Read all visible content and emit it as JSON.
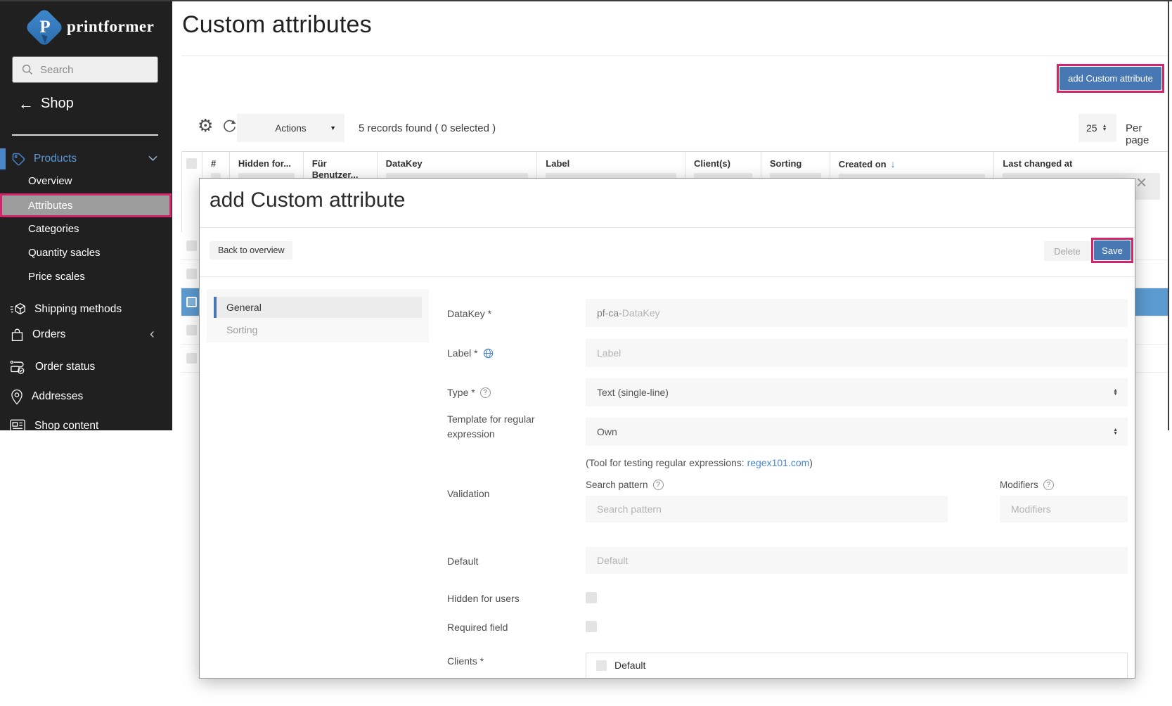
{
  "page": {
    "title": "Custom attributes"
  },
  "sidebar": {
    "logo": "printformer",
    "logo_letter": "P",
    "search": {
      "placeholder": "Search"
    },
    "back": {
      "label": "Shop"
    },
    "products": {
      "label": "Products",
      "items": [
        "Overview",
        "Attributes",
        "Categories",
        "Quantity sacles",
        "Price scales"
      ],
      "active_item": "Attributes"
    },
    "items": [
      "Shipping methods",
      "Orders",
      "Order status",
      "Addresses",
      "Shop content"
    ]
  },
  "toolbar": {
    "actions": "Actions",
    "records": "5 records found ( 0 selected )",
    "per_page_value": "25",
    "per_page_label": "Per page",
    "add_button": "add Custom attribute"
  },
  "table": {
    "columns": [
      "#",
      "Hidden for...",
      "Für Benutzer...",
      "DataKey",
      "Label",
      "Client(s)",
      "Sorting",
      "Created on",
      "Last changed at"
    ],
    "sorted_column": "Created on"
  },
  "modal": {
    "title": "add Custom attribute",
    "back_button": "Back to overview",
    "delete_button": "Delete",
    "save_button": "Save",
    "nav": {
      "general": "General",
      "sorting": "Sorting",
      "active": "General"
    },
    "form": {
      "datakey": {
        "label": "DataKey *",
        "prefix": "pf-ca-",
        "placeholder": "DataKey"
      },
      "label": {
        "label": "Label *",
        "placeholder": "Label"
      },
      "type": {
        "label": "Type *",
        "value": "Text (single-line)"
      },
      "template": {
        "label": "Template for regular expression",
        "value": "Own"
      },
      "regex_note": {
        "prefix": "(Tool for testing regular expressions: ",
        "link": "regex101.com",
        "suffix": ")"
      },
      "validation": {
        "label": "Validation",
        "search_pattern": {
          "label": "Search pattern",
          "placeholder": "Search pattern"
        },
        "modifiers": {
          "label": "Modifiers",
          "placeholder": "Modifiers"
        }
      },
      "default": {
        "label": "Default",
        "placeholder": "Default"
      },
      "hidden_for_users": {
        "label": "Hidden for users",
        "checked": false
      },
      "required_field": {
        "label": "Required field",
        "checked": false
      },
      "clients": {
        "label": "Clients *",
        "options": [
          "Default"
        ]
      }
    }
  },
  "icons": {
    "gear": "⚙",
    "dropdown": "▼",
    "sort_desc": "↓",
    "back_arrow": "←",
    "chevron_left": "‹",
    "close": "×",
    "select_up": "▲",
    "select_down": "▼",
    "question": "?"
  },
  "colors": {
    "accent_blue": "#4878b3",
    "annotation_pink": "#d2256e",
    "selected_row": "#5b9ad0",
    "link_blue": "#4a86c8",
    "sidebar_bg": "#202020"
  }
}
